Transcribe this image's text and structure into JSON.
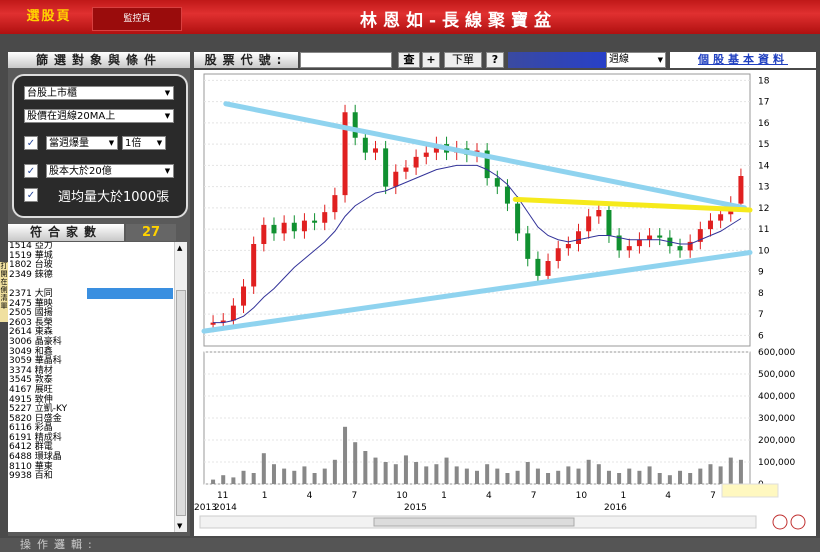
{
  "header": {
    "tab_screener": "選股頁",
    "tab_monitor": "監控頁",
    "title": "林恩如-長線聚寶盆"
  },
  "filters": {
    "heading": "篩選對象與條件",
    "market": "台股上市櫃",
    "price_condition": "股價在週線20MA上",
    "volume_surge_checked": true,
    "volume_surge": "當週爆量",
    "volume_multiple": "1倍",
    "capital_checked": true,
    "capital": "股本大於20億",
    "weekly_volume_checked": true,
    "weekly_volume": "週均量大於1000張"
  },
  "match": {
    "label": "符合家數",
    "count": "27"
  },
  "side_tab": "打開在側清單",
  "stock_list": [
    "1514 亞力",
    "1519 華城",
    "1802 台玻",
    "2349 錸德",
    "",
    "2371 大同",
    "2475 華映",
    "2505 國揚",
    "2603 長榮",
    "2614 東森",
    "3006 晶豪科",
    "3049 和鑫",
    "3059 華晶科",
    "3374 精材",
    "3545 敦泰",
    "4167 展旺",
    "4915 致伸",
    "5227 立凱-KY",
    "5820 日盛金",
    "6116 彩晶",
    "6191 精成科",
    "6412 群電",
    "6488 環球晶",
    "8110 華東",
    "9938 百和"
  ],
  "toolbar": {
    "code_label": "股票代號:",
    "code_value": "",
    "query_btn": "查",
    "add_btn": "+",
    "order_btn": "下單",
    "help_btn": "?",
    "period": "週線",
    "basic_info_link": "個股基本資料"
  },
  "chart_data": {
    "type": "candlestick",
    "price_axis": {
      "ticks": [
        6,
        7,
        8,
        9,
        10,
        11,
        12,
        13,
        14,
        15,
        16,
        17,
        18
      ],
      "range": [
        5.5,
        18.3
      ]
    },
    "volume_axis": {
      "ticks": [
        "0",
        "100,000",
        "200,000",
        "300,000",
        "400,000",
        "500,000",
        "600,000"
      ],
      "range": [
        0,
        600000
      ]
    },
    "x_tick_labels": [
      "11",
      "1",
      "4",
      "7",
      "10",
      "1",
      "4",
      "7",
      "10",
      "1",
      "4",
      "7"
    ],
    "year_labels": [
      "2013",
      "2014",
      "2015",
      "2016"
    ],
    "close_series": [
      6.6,
      6.7,
      7.4,
      8.3,
      10.3,
      11.2,
      10.8,
      11.3,
      10.9,
      11.4,
      11.3,
      11.8,
      12.6,
      16.5,
      15.3,
      14.6,
      14.8,
      13.0,
      13.7,
      13.9,
      14.4,
      14.6,
      15.0,
      14.6,
      14.8,
      14.5,
      14.7,
      13.4,
      13.0,
      12.2,
      10.8,
      9.6,
      8.8,
      9.5,
      10.1,
      10.3,
      10.9,
      11.6,
      11.9,
      10.7,
      10.0,
      10.2,
      10.5,
      10.7,
      10.6,
      10.2,
      10.0,
      10.4,
      11.0,
      11.4,
      11.7,
      12.2,
      13.5
    ],
    "ma_series": [
      6.6,
      6.6,
      6.7,
      6.9,
      7.3,
      7.8,
      8.2,
      8.7,
      9.2,
      9.6,
      10.0,
      10.4,
      10.9,
      11.6,
      12.1,
      12.4,
      12.7,
      12.8,
      13.0,
      13.2,
      13.4,
      13.6,
      13.8,
      13.9,
      14.0,
      14.0,
      14.0,
      13.8,
      13.5,
      13.1,
      12.5,
      11.8,
      11.1,
      10.7,
      10.5,
      10.4,
      10.5,
      10.6,
      10.7,
      10.7,
      10.6,
      10.5,
      10.5,
      10.5,
      10.5,
      10.4,
      10.3,
      10.3,
      10.5,
      10.7,
      10.9,
      11.2,
      11.5
    ],
    "volume_series": [
      20000,
      40000,
      30000,
      60000,
      50000,
      140000,
      90000,
      70000,
      60000,
      80000,
      50000,
      70000,
      110000,
      260000,
      190000,
      150000,
      120000,
      100000,
      90000,
      130000,
      100000,
      80000,
      90000,
      120000,
      80000,
      70000,
      60000,
      90000,
      70000,
      50000,
      60000,
      100000,
      70000,
      50000,
      60000,
      80000,
      70000,
      110000,
      90000,
      60000,
      50000,
      70000,
      60000,
      80000,
      50000,
      40000,
      60000,
      50000,
      70000,
      90000,
      80000,
      120000,
      110000
    ],
    "trendlines": [
      {
        "color": "#8fd3ef",
        "points": [
          [
            0.04,
            16.9
          ],
          [
            0.99,
            12.0
          ]
        ]
      },
      {
        "color": "#8fd3ef",
        "points": [
          [
            0.0,
            6.2
          ],
          [
            1.0,
            9.9
          ]
        ]
      },
      {
        "color": "#f6ea1c",
        "points": [
          [
            0.57,
            12.4
          ],
          [
            1.0,
            11.9
          ]
        ]
      }
    ],
    "colors": {
      "up": "#e02020",
      "down": "#109030",
      "ma": "#333399",
      "volume": "#888888"
    }
  },
  "footer": {
    "label": "操作邏輯:"
  }
}
